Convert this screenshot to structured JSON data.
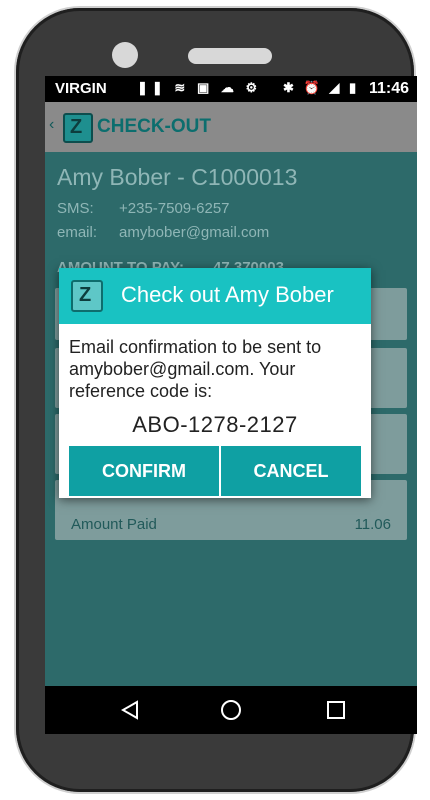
{
  "status_bar": {
    "carrier": "VIRGIN",
    "time": "11:46",
    "left_icons": [
      "pause-icon",
      "wifi-icon",
      "image-icon",
      "cloud-icon",
      "android-icon"
    ],
    "right_icons": [
      "bluetooth-icon",
      "alarm-icon",
      "signal-icon",
      "battery-icon"
    ]
  },
  "app_bar": {
    "title": "CHECK-OUT",
    "logo_glyph": "Z"
  },
  "customer": {
    "name": "Amy Bober - C1000013",
    "sms_label": "SMS:",
    "sms_value": "+235-7509-6257",
    "email_label": "email:",
    "email_value": "amybober@gmail.com"
  },
  "amount": {
    "label": "AMOUNT TO PAY:",
    "value": "47.370003"
  },
  "payments": {
    "last_label": "Amount Paid",
    "last_value": "11.06"
  },
  "dialog": {
    "title": "Check out Amy Bober",
    "message": "Email confirmation to be sent to amybober@gmail.com. Your reference code is:",
    "code": "ABO-1278-2127",
    "confirm_label": "CONFIRM",
    "cancel_label": "CANCEL"
  },
  "colors": {
    "accent": "#19c2c2",
    "button": "#0fa0a3",
    "background": "#2d6a6a"
  }
}
